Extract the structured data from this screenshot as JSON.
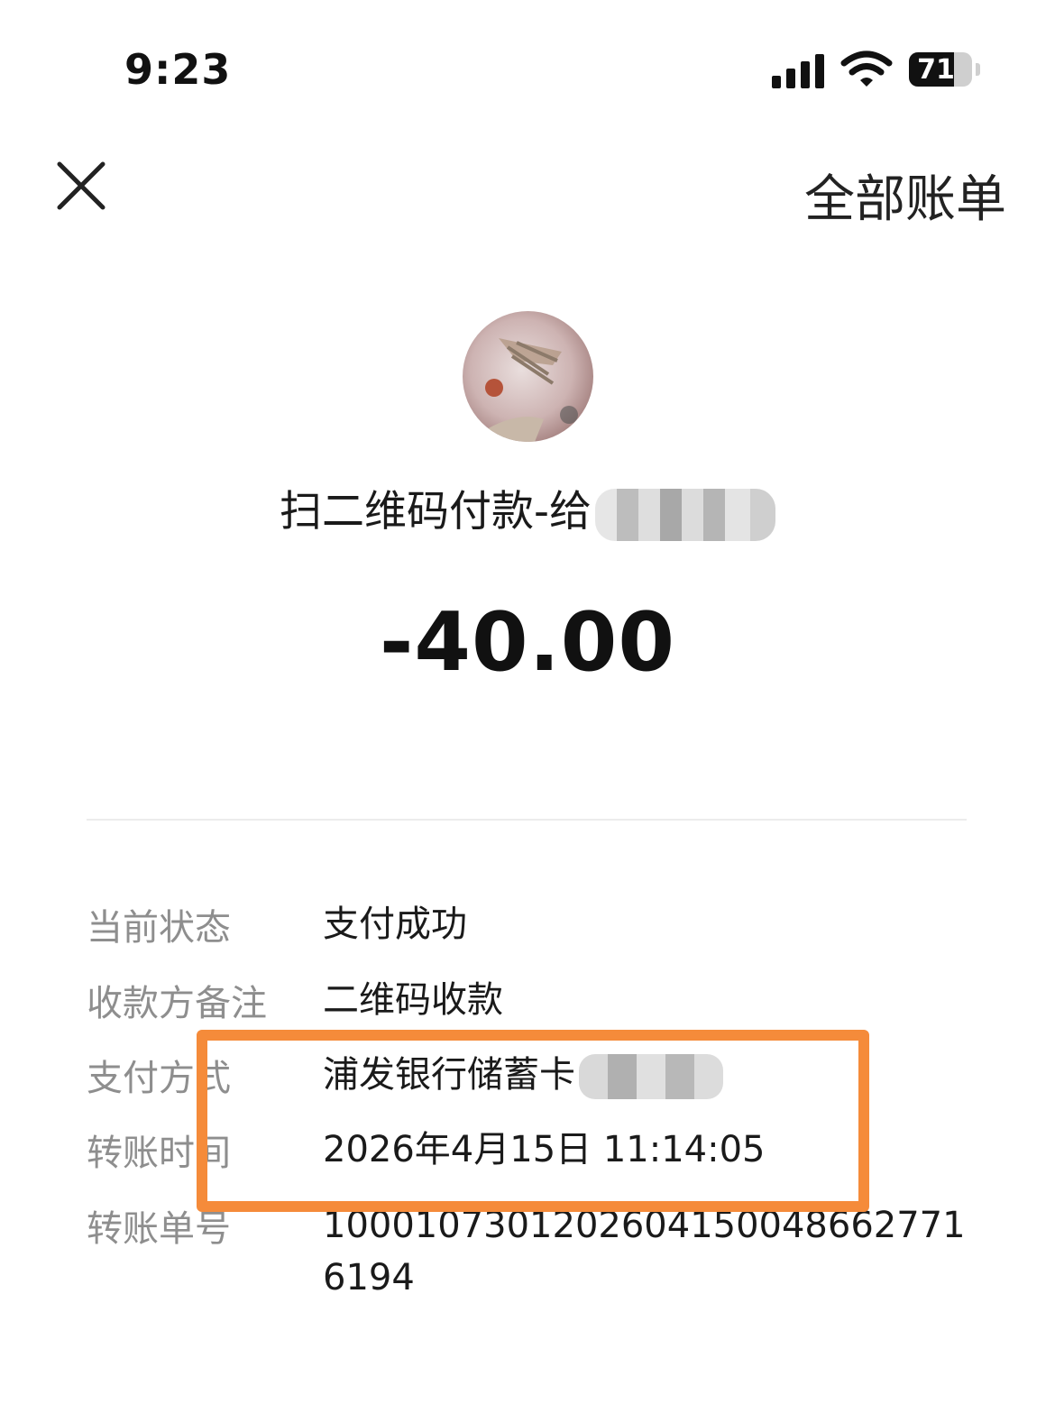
{
  "status_bar": {
    "time": "9:23",
    "battery": "71",
    "battery_level": 0.71
  },
  "header": {
    "close_icon": "close-icon",
    "all_bills": "全部账单"
  },
  "merchant": {
    "title": "扫二维码付款-给"
  },
  "amount": "-40.00",
  "details": {
    "status_label": "当前状态",
    "status_value": "支付成功",
    "remark_label": "收款方备注",
    "remark_value": "二维码收款",
    "method_label": "支付方式",
    "method_value": "浦发银行储蓄卡",
    "time_label": "转账时间",
    "time_value": "2026年4月15日 11:14:05",
    "order_label": "转账单号",
    "order_value": "1000107301202604150048662771 6194"
  },
  "colors": {
    "highlight": "#f58b3a"
  }
}
